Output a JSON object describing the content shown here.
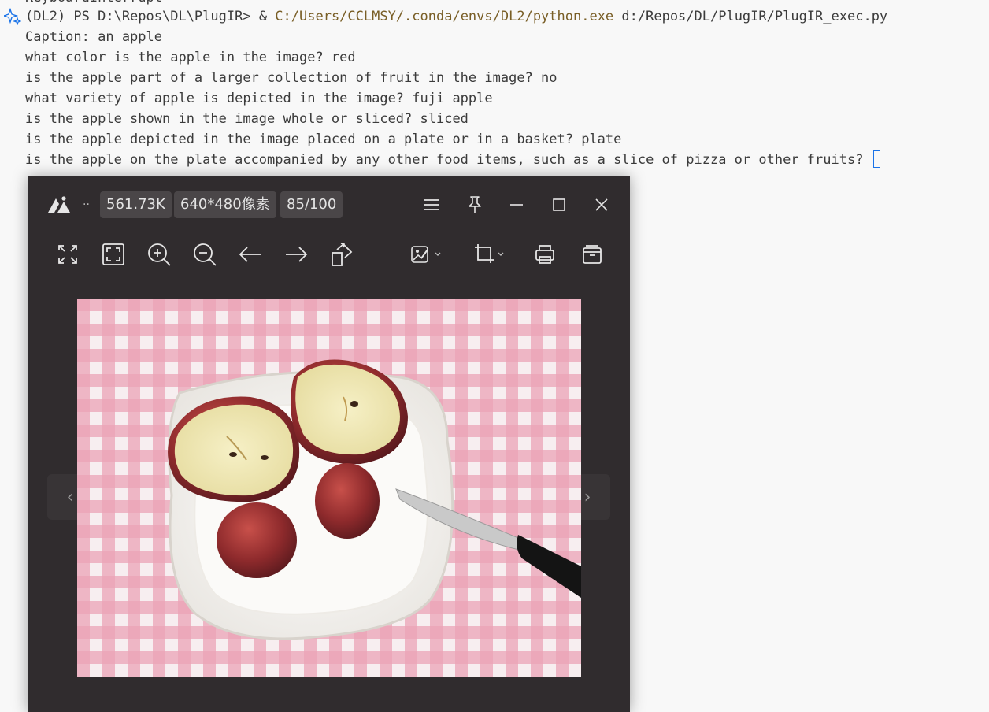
{
  "terminal": {
    "previous_line": "KeyboardInterrupt",
    "prompt_env": "(DL2) PS D:\\Repos\\DL\\PlugIR>",
    "prompt_amp": " & ",
    "exe_path": "C:/Users/CCLMSY/.conda/envs/DL2/python.exe",
    "script_path": " d:/Repos/DL/PlugIR/PlugIR_exec.py",
    "lines": [
      "Caption: an apple",
      "what color is the apple in the image? red",
      "is the apple part of a larger collection of fruit in the image? no",
      "what variety of apple is depicted in the image? fuji apple",
      "is the apple shown in the image whole or sliced? sliced",
      "is the apple depicted in the image placed on a plate or in a basket? plate",
      "is the apple on the plate accompanied by any other food items, such as a slice of pizza or other fruits? "
    ],
    "colors": {
      "text": "#3b3b3b",
      "exe": "#795e26",
      "cursor": "#1a73e8"
    }
  },
  "viewer": {
    "more_label": "..",
    "file_size": "561.73K",
    "dimensions": "640*480像素",
    "quality": "85/100",
    "toolbar_icons": [
      "fullscreen-icon",
      "fit-window-icon",
      "zoom-in-icon",
      "zoom-out-icon",
      "previous-arrow-icon",
      "next-arrow-icon",
      "rotate-icon",
      "edit-image-icon",
      "crop-icon",
      "print-icon",
      "delete-icon"
    ],
    "window_icons": [
      "menu-icon",
      "pin-icon",
      "minimize-icon",
      "maximize-icon",
      "close-icon"
    ],
    "nav_prev": "‹",
    "nav_next": "›",
    "colors": {
      "background": "#302c2e",
      "pill": "#4a4648",
      "icon": "#e6e6e6"
    }
  }
}
